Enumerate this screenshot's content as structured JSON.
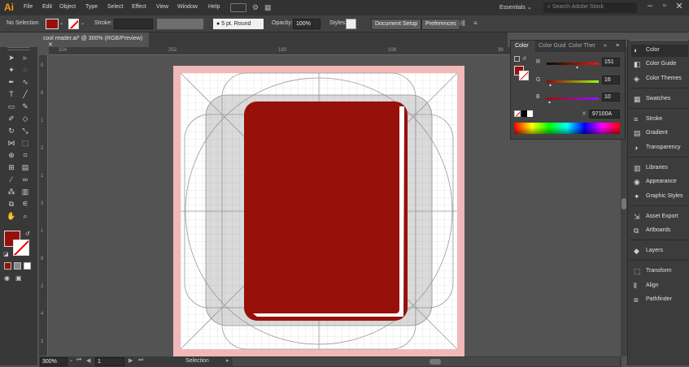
{
  "app": {
    "logo": "Ai"
  },
  "menu": [
    "File",
    "Edit",
    "Object",
    "Type",
    "Select",
    "Effect",
    "View",
    "Window",
    "Help"
  ],
  "workspace": "Essentials",
  "search": {
    "placeholder": "Search Adobe Stock"
  },
  "control": {
    "selection": "No Selection",
    "stroke_label": "Stroke:",
    "brush": "5 pt. Round",
    "opacity_label": "Opacity:",
    "opacity_value": "100%",
    "styles_label": "Styles:",
    "doc_setup": "Document Setup",
    "preferences": "Preferences"
  },
  "doc_tab": {
    "title": "cool reader.ai* @ 300% (RGB/Preview)",
    "close": "✕"
  },
  "ruler": {
    "top": [
      "324",
      "252",
      "180",
      "108",
      "36"
    ],
    "left": [
      "0",
      "6",
      "1",
      "2",
      "1",
      "3",
      "1",
      "8",
      "2",
      "4",
      "3"
    ]
  },
  "color_panel": {
    "tabs": [
      "Color",
      "Color Guid",
      "Color Ther"
    ],
    "R": "151",
    "G": "16",
    "B": "10",
    "hex": "97100A",
    "fill": "#97100a"
  },
  "dock": {
    "items": [
      "Color",
      "Color Guide",
      "Color Themes",
      "Swatches",
      "Stroke",
      "Gradient",
      "Transparency",
      "Libraries",
      "Appearance",
      "Graphic Styles",
      "Asset Export",
      "Artboards",
      "Layers",
      "Transform",
      "Align",
      "Pathfinder"
    ]
  },
  "status": {
    "zoom": "300%",
    "artboard": "1",
    "tool": "Selection"
  },
  "colors": {
    "book": "#97100a",
    "page_fill": "#ffffff",
    "bleed": "#f0b8b8",
    "canvas": "#535353"
  }
}
